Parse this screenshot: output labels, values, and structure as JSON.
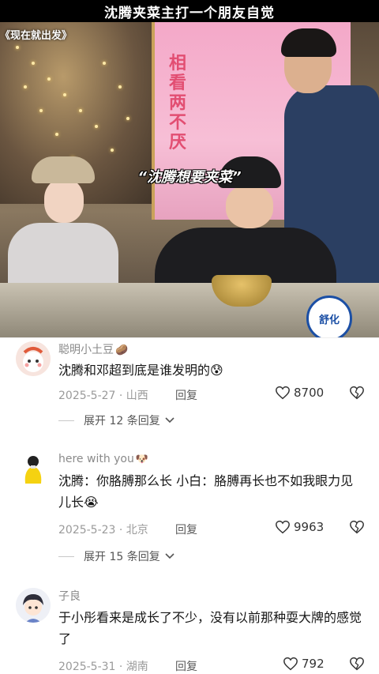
{
  "header": {
    "title": "沈腾夹菜主打一个朋友自觉"
  },
  "video": {
    "caption_top_left": "《现在就出发》",
    "caption_center": "“沈腾想要夹菜”",
    "sign_text": "相看两不厌",
    "brand_badge": "舒化"
  },
  "comments": [
    {
      "author": "聪明小土豆",
      "author_emoji": "🥔",
      "text": "沈腾和邓超到底是谁发明的😰",
      "date_location": "2025-5-27 · 山西",
      "reply_label": "回复",
      "likes": "8700",
      "expand_label": "展开 12 条回复"
    },
    {
      "author": "here with you",
      "author_emoji": "🐶",
      "text": "沈腾：你胳膊那么长  小白：胳膊再长也不如我眼力见儿长😭",
      "date_location": "2025-5-23 · 北京",
      "reply_label": "回复",
      "likes": "9963",
      "expand_label": "展开 15 条回复"
    },
    {
      "author": "子良",
      "author_emoji": "",
      "text": "于小彤看来是成长了不少，没有以前那种耍大牌的感觉了",
      "date_location": "2025-5-31 · 湖南",
      "reply_label": "回复",
      "likes": "792",
      "expand_label": ""
    }
  ],
  "icons": {
    "like": "heart-outline-icon",
    "dislike": "broken-heart-icon",
    "expand": "chevron-down-icon"
  }
}
